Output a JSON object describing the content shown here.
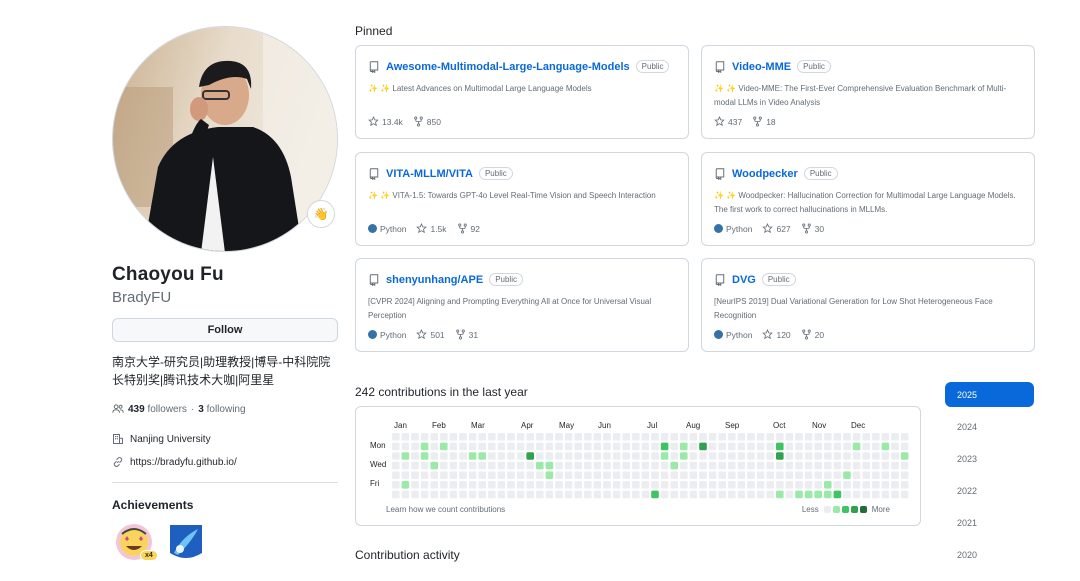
{
  "profile": {
    "name": "Chaoyou Fu",
    "login": "BradyFU",
    "follow_label": "Follow",
    "bio_line1": "南京大学-研究员|助理教授|博导-中科院院",
    "bio_line2": "长特别奖|腾讯技术大咖|阿里星",
    "followers_count": "439",
    "followers_label": "followers",
    "dot": "·",
    "following_count": "3",
    "following_label": "following",
    "organization": "Nanjing University",
    "website": "https://bradyfu.github.io/",
    "achievements_title": "Achievements",
    "achievement_count": "x4",
    "status_emoji_icon": "hand-emoji-icon"
  },
  "pinned": {
    "title": "Pinned",
    "cards": [
      {
        "name": "Awesome-Multimodal-Large-Language-Models",
        "visibility": "Public",
        "description": "✨ ✨ Latest Advances on Multimodal Large Language Models",
        "language": "",
        "stars": "13.4k",
        "forks": "850"
      },
      {
        "name": "Video-MME",
        "visibility": "Public",
        "description": "✨ ✨ Video-MME: The First-Ever Comprehensive Evaluation Benchmark of Multi-modal LLMs in Video Analysis",
        "language": "",
        "stars": "437",
        "forks": "18"
      },
      {
        "name": "VITA-MLLM/VITA",
        "visibility": "Public",
        "description": "✨ ✨ VITA-1.5: Towards GPT-4o Level Real-Time Vision and Speech Interaction",
        "language": "Python",
        "stars": "1.5k",
        "forks": "92"
      },
      {
        "name": "Woodpecker",
        "visibility": "Public",
        "description": "✨ ✨ Woodpecker: Hallucination Correction for Multimodal Large Language Models. The first work to correct hallucinations in MLLMs.",
        "language": "Python",
        "stars": "627",
        "forks": "30"
      },
      {
        "name": "shenyunhang/APE",
        "visibility": "Public",
        "description": "[CVPR 2024] Aligning and Prompting Everything All at Once for Universal Visual Perception",
        "language": "Python",
        "stars": "501",
        "forks": "31"
      },
      {
        "name": "DVG",
        "visibility": "Public",
        "description": "[NeurIPS 2019] Dual Variational Generation for Low Shot Heterogeneous Face Recognition",
        "language": "Python",
        "stars": "120",
        "forks": "20"
      }
    ],
    "python_color": "#3572A5"
  },
  "contributions": {
    "title": "242 contributions in the last year",
    "months": [
      "Jan",
      "Feb",
      "Mar",
      "Apr",
      "May",
      "Jun",
      "Jul",
      "Aug",
      "Sep",
      "Oct",
      "Nov",
      "Dec"
    ],
    "days": [
      "Mon",
      "Wed",
      "Fri"
    ],
    "learn_link": "Learn how we count contributions",
    "less_label": "Less",
    "more_label": "More",
    "levels": [
      "#ebedf0",
      "#9be9a8",
      "#40c463",
      "#30a14e",
      "#216e39"
    ],
    "cells": [
      [
        0,
        0,
        0,
        0,
        0,
        0,
        0
      ],
      [
        0,
        0,
        1,
        0,
        0,
        1,
        0
      ],
      [
        0,
        0,
        0,
        0,
        0,
        0,
        0
      ],
      [
        0,
        1,
        1,
        0,
        0,
        0,
        0
      ],
      [
        0,
        0,
        0,
        1,
        0,
        0,
        0
      ],
      [
        0,
        1,
        0,
        0,
        0,
        0,
        0
      ],
      [
        0,
        0,
        0,
        0,
        0,
        0,
        0
      ],
      [
        0,
        0,
        0,
        0,
        0,
        0,
        0
      ],
      [
        0,
        0,
        1,
        0,
        0,
        0,
        0
      ],
      [
        0,
        0,
        1,
        0,
        0,
        0,
        0
      ],
      [
        0,
        0,
        0,
        0,
        0,
        0,
        0
      ],
      [
        0,
        0,
        0,
        0,
        0,
        0,
        0
      ],
      [
        0,
        0,
        0,
        0,
        0,
        0,
        0
      ],
      [
        0,
        0,
        0,
        0,
        0,
        0,
        0
      ],
      [
        0,
        0,
        3,
        0,
        0,
        0,
        0
      ],
      [
        0,
        0,
        0,
        1,
        0,
        0,
        0
      ],
      [
        0,
        0,
        0,
        1,
        1,
        0,
        0
      ],
      [
        0,
        0,
        0,
        0,
        0,
        0,
        0
      ],
      [
        0,
        0,
        0,
        0,
        0,
        0,
        0
      ],
      [
        0,
        0,
        0,
        0,
        0,
        0,
        0
      ],
      [
        0,
        0,
        0,
        0,
        0,
        0,
        0
      ],
      [
        0,
        0,
        0,
        0,
        0,
        0,
        0
      ],
      [
        0,
        0,
        0,
        0,
        0,
        0,
        0
      ],
      [
        0,
        0,
        0,
        0,
        0,
        0,
        0
      ],
      [
        0,
        0,
        0,
        0,
        0,
        0,
        0
      ],
      [
        0,
        0,
        0,
        0,
        0,
        0,
        0
      ],
      [
        0,
        0,
        0,
        0,
        0,
        0,
        0
      ],
      [
        0,
        0,
        0,
        0,
        0,
        0,
        2
      ],
      [
        0,
        2,
        1,
        0,
        0,
        0,
        0
      ],
      [
        0,
        0,
        0,
        1,
        0,
        0,
        0
      ],
      [
        0,
        1,
        1,
        0,
        0,
        0,
        0
      ],
      [
        0,
        0,
        0,
        0,
        0,
        0,
        0
      ],
      [
        0,
        3,
        0,
        0,
        0,
        0,
        0
      ],
      [
        0,
        0,
        0,
        0,
        0,
        0,
        0
      ],
      [
        0,
        0,
        0,
        0,
        0,
        0,
        0
      ],
      [
        0,
        0,
        0,
        0,
        0,
        0,
        0
      ],
      [
        0,
        0,
        0,
        0,
        0,
        0,
        0
      ],
      [
        0,
        0,
        0,
        0,
        0,
        0,
        0
      ],
      [
        0,
        0,
        0,
        0,
        0,
        0,
        0
      ],
      [
        0,
        0,
        0,
        0,
        0,
        0,
        0
      ],
      [
        0,
        2,
        3,
        0,
        0,
        0,
        1
      ],
      [
        0,
        0,
        0,
        0,
        0,
        0,
        0
      ],
      [
        0,
        0,
        0,
        0,
        0,
        0,
        1
      ],
      [
        0,
        0,
        0,
        0,
        0,
        0,
        1
      ],
      [
        0,
        0,
        0,
        0,
        0,
        0,
        1
      ],
      [
        0,
        0,
        0,
        0,
        0,
        1,
        1
      ],
      [
        0,
        0,
        0,
        0,
        0,
        0,
        2
      ],
      [
        0,
        0,
        0,
        0,
        1,
        0,
        0
      ],
      [
        0,
        1,
        0,
        0,
        0,
        0,
        0
      ],
      [
        0,
        0,
        0,
        0,
        0,
        0,
        0
      ],
      [
        0,
        0,
        0,
        0,
        0,
        0,
        0
      ],
      [
        0,
        1,
        0,
        0,
        0,
        0,
        0
      ],
      [
        0,
        0,
        0,
        0,
        0,
        0,
        0
      ],
      [
        0,
        0,
        1,
        0,
        0,
        0,
        0
      ]
    ]
  },
  "activity": {
    "title": "Contribution activity"
  },
  "years": [
    "2025",
    "2024",
    "2023",
    "2022",
    "2021",
    "2020"
  ],
  "active_year": "2025"
}
